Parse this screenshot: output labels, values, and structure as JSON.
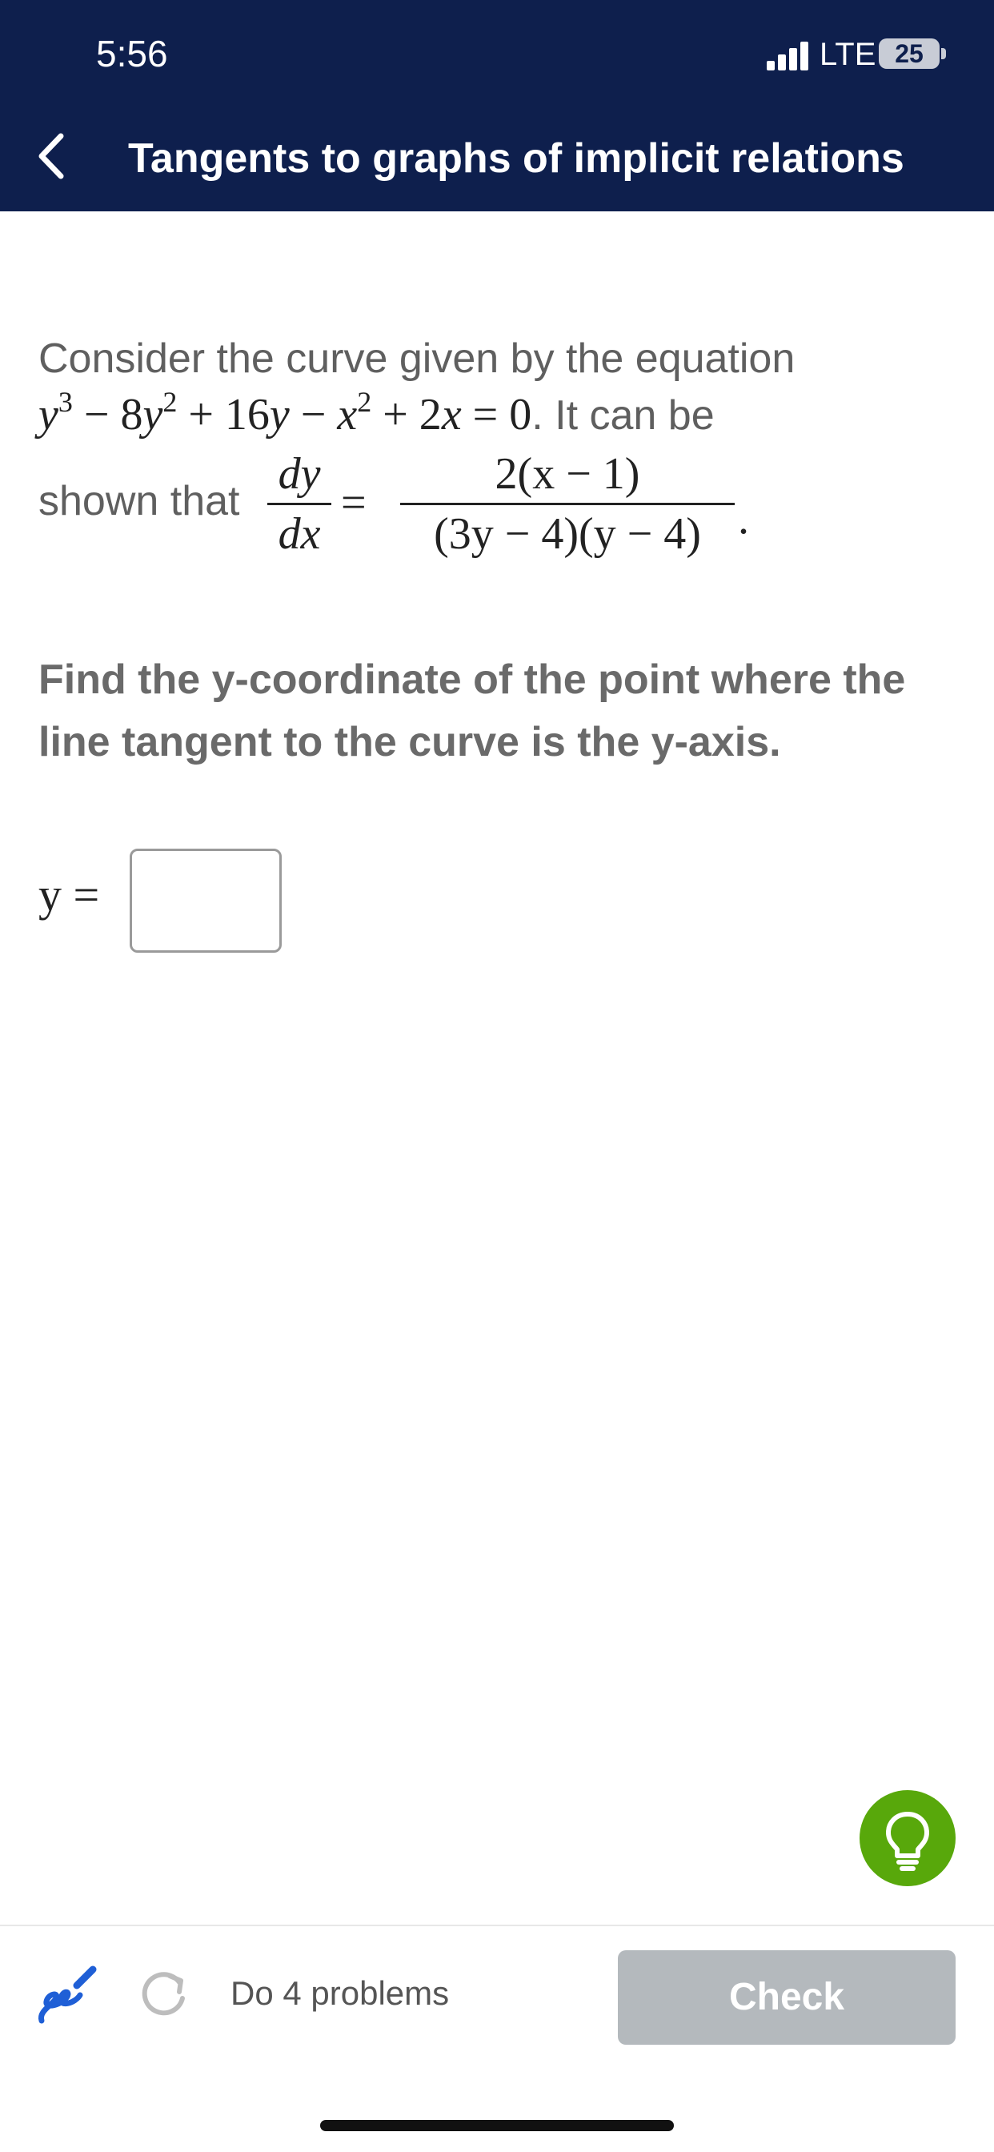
{
  "status_bar": {
    "time": "5:56",
    "network": "LTE",
    "battery": "25"
  },
  "header": {
    "title": "Tangents to graphs of implicit relations"
  },
  "problem": {
    "intro": "Consider the curve given by the equation",
    "equation": {
      "t1": "y",
      "e1": "3",
      "t2": " − 8",
      "t3": "y",
      "e2": "2",
      "t4": " + 16",
      "t5": "y",
      "t6": " − ",
      "t7": "x",
      "e3": "2",
      "t8": " + 2",
      "t9": "x",
      "t10": " = 0"
    },
    "after_equation": ". It can be",
    "shown_that": "shown that",
    "lhs_num": "dy",
    "lhs_den": "dx",
    "equals": "=",
    "rhs_num": "2(x − 1)",
    "rhs_den": "(3y − 4)(y − 4)",
    "period": "."
  },
  "question": "Find the y-coordinate of the point where the line tangent to the curve is the y-axis.",
  "answer": {
    "label": "y =",
    "value": ""
  },
  "footer": {
    "do_problems": "Do 4 problems",
    "check_label": "Check"
  },
  "colors": {
    "header_bg": "#0e1f4d",
    "hint_green": "#58a80b",
    "check_disabled": "#b4b9bd",
    "pen_blue": "#1f5fd6"
  },
  "icons": {
    "back": "chevron-left-icon",
    "hint": "lightbulb-icon",
    "pen": "scribble-pen-icon",
    "refresh": "refresh-icon",
    "signal": "signal-bars-icon"
  }
}
